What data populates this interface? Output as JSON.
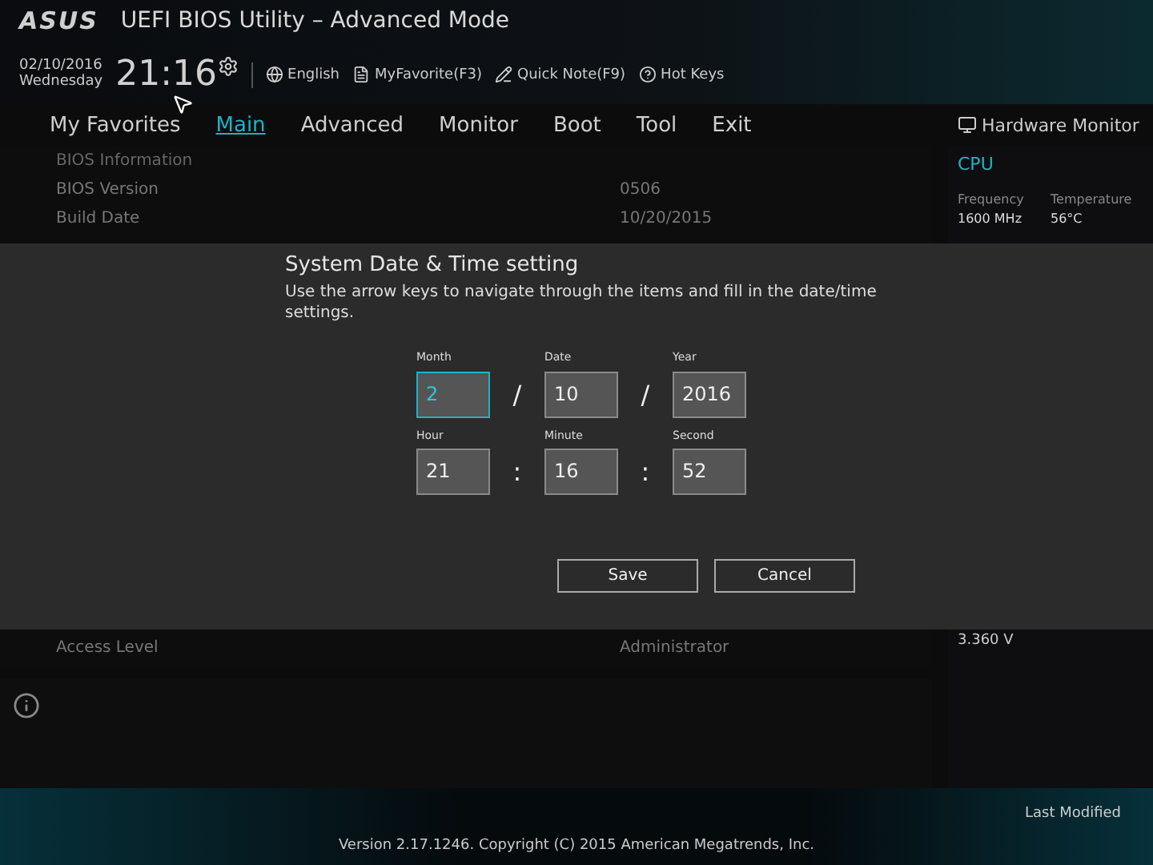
{
  "header": {
    "logo": "ASUS",
    "title": "UEFI BIOS Utility – Advanced Mode",
    "date": "02/10/2016",
    "weekday": "Wednesday",
    "time": "21:16",
    "tools": [
      {
        "kind": "globe",
        "label": "English"
      },
      {
        "kind": "favorite",
        "label": "MyFavorite(F3)"
      },
      {
        "kind": "note",
        "label": "Quick Note(F9)"
      },
      {
        "kind": "help",
        "label": "Hot Keys"
      }
    ]
  },
  "tabs": [
    {
      "label": "My Favorites",
      "selected": false
    },
    {
      "label": "Main",
      "selected": true
    },
    {
      "label": "Advanced",
      "selected": false
    },
    {
      "label": "Monitor",
      "selected": false
    },
    {
      "label": "Boot",
      "selected": false
    },
    {
      "label": "Tool",
      "selected": false
    },
    {
      "label": "Exit",
      "selected": false
    }
  ],
  "main": {
    "section": "BIOS Information",
    "rows": [
      {
        "label": "BIOS Version",
        "value": "0506"
      },
      {
        "label": "Build Date",
        "value": "10/20/2015"
      }
    ],
    "bottom_row": {
      "label": "Access Level",
      "value": "Administrator"
    }
  },
  "hardware_monitor": {
    "title": "Hardware Monitor",
    "cpu": "CPU",
    "columns": [
      {
        "label": "Frequency",
        "value": "1600 MHz"
      },
      {
        "label": "Temperature",
        "value": "56°C"
      }
    ],
    "voltage": "3.360 V"
  },
  "dialog": {
    "title": "System Date & Time setting",
    "text": "Use the arrow keys to navigate through the items and fill in the date/time settings.",
    "rows": [
      {
        "separator": "/",
        "fields": [
          {
            "label": "Month",
            "value": "2",
            "selected": true
          },
          {
            "label": "Date",
            "value": "10",
            "selected": false
          },
          {
            "label": "Year",
            "value": "2016",
            "selected": false
          }
        ]
      },
      {
        "separator": ":",
        "fields": [
          {
            "label": "Hour",
            "value": "21",
            "selected": false
          },
          {
            "label": "Minute",
            "value": "16",
            "selected": false
          },
          {
            "label": "Second",
            "value": "52",
            "selected": false
          }
        ]
      }
    ],
    "buttons": [
      "Save",
      "Cancel"
    ]
  },
  "footer": {
    "last_modified": "Last Modified",
    "version": "Version 2.17.1246. Copyright (C) 2015 American Megatrends, Inc."
  }
}
